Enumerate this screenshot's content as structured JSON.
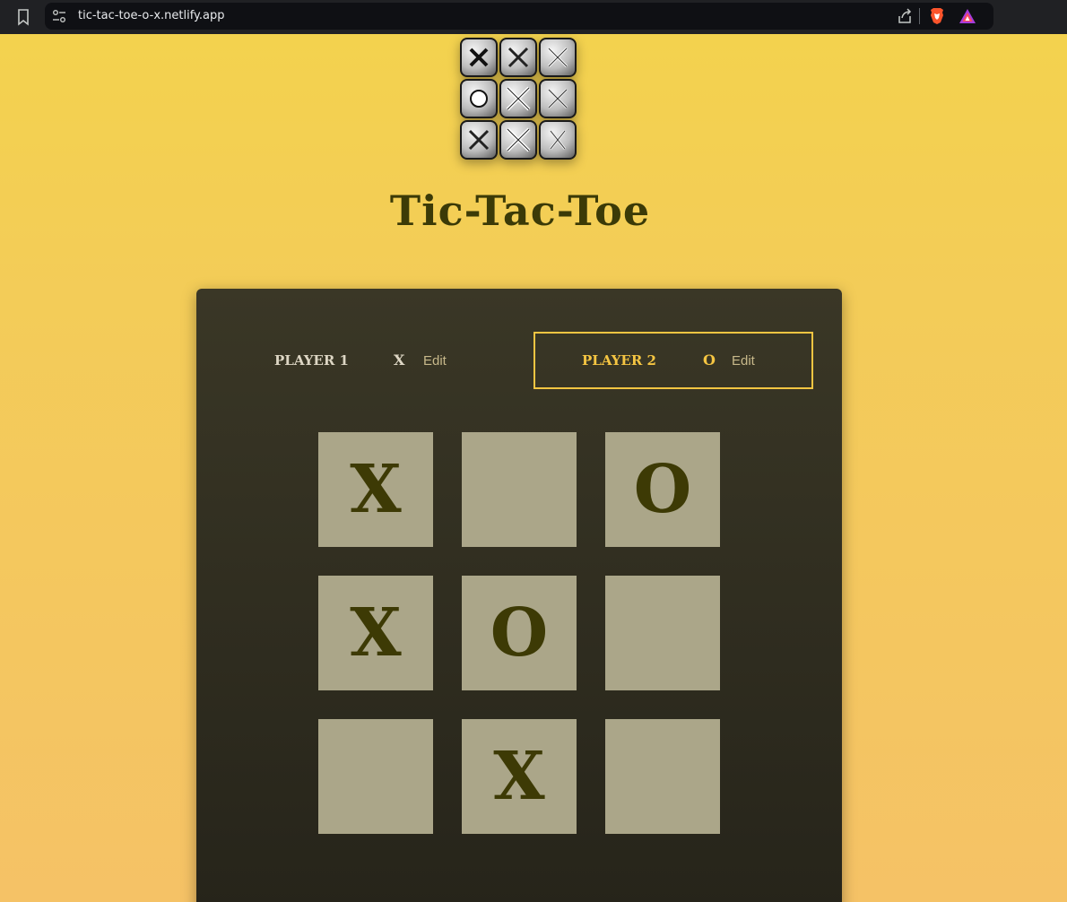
{
  "browser": {
    "url": "tic-tac-toe-o-x.netlify.app",
    "icons": [
      "bookmark-icon",
      "site-settings-icon",
      "share-icon",
      "brave-shields-icon",
      "brave-rewards-icon"
    ]
  },
  "header": {
    "logo_icon": "tic-tac-toe-logo-icon",
    "title": "Tic-Tac-Toe"
  },
  "players": [
    {
      "name": "PLAYER 1",
      "symbol": "X",
      "edit_label": "Edit",
      "active": false
    },
    {
      "name": "PLAYER 2",
      "symbol": "O",
      "edit_label": "Edit",
      "active": true
    }
  ],
  "board": [
    [
      "X",
      "",
      "O"
    ],
    [
      "X",
      "O",
      ""
    ],
    [
      "",
      "X",
      ""
    ]
  ],
  "colors": {
    "background_top": "#f3d24e",
    "background_bottom": "#f5c266",
    "panel": "#3a3726",
    "cell": "#aba689",
    "mark": "#3d3a05",
    "active_accent": "#f5c542"
  }
}
